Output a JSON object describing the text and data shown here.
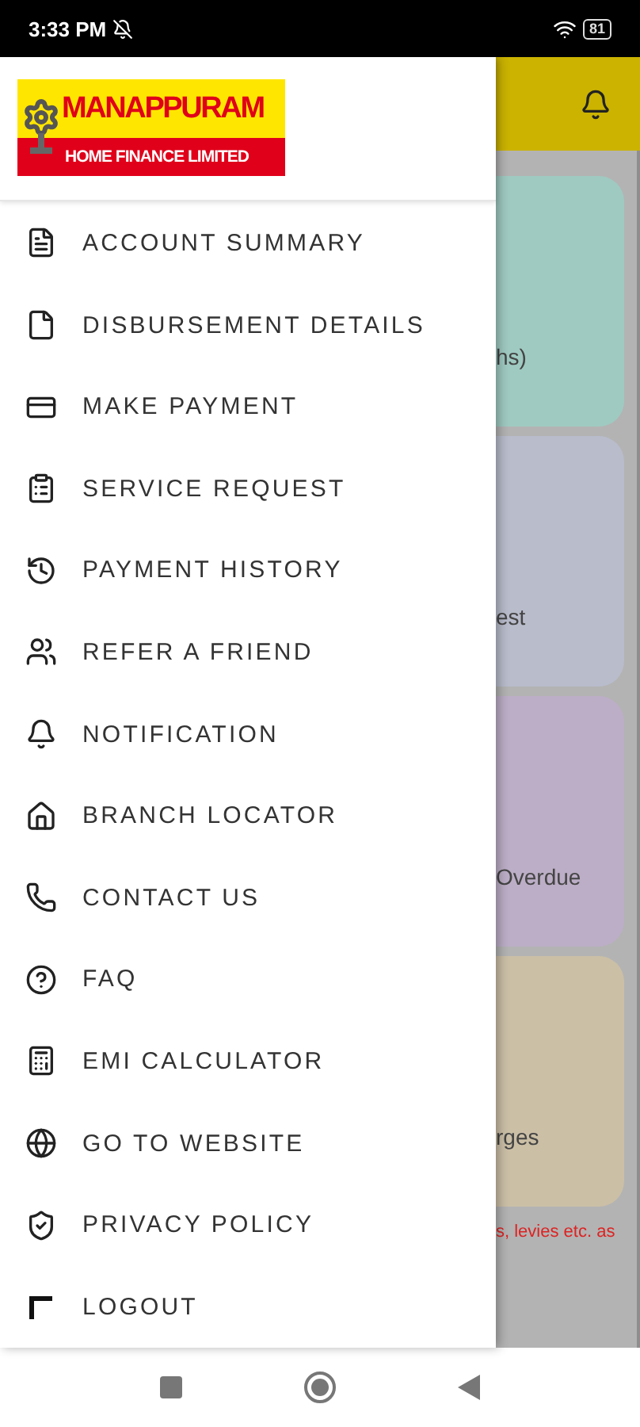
{
  "status_bar": {
    "time": "3:33 PM",
    "battery": "81"
  },
  "drawer": {
    "logo": {
      "title": "MANAPPURAM",
      "subtitle": "HOME FINANCE LIMITED"
    },
    "items": [
      {
        "label": "ACCOUNT SUMMARY"
      },
      {
        "label": "DISBURSEMENT DETAILS"
      },
      {
        "label": "MAKE PAYMENT"
      },
      {
        "label": "SERVICE REQUEST"
      },
      {
        "label": "PAYMENT HISTORY"
      },
      {
        "label": "REFER A FRIEND"
      },
      {
        "label": "NOTIFICATION"
      },
      {
        "label": "BRANCH LOCATOR"
      },
      {
        "label": "CONTACT US"
      },
      {
        "label": "FAQ"
      },
      {
        "label": "EMI CALCULATOR"
      },
      {
        "label": "GO TO WEBSITE"
      },
      {
        "label": "PRIVACY POLICY"
      },
      {
        "label": "LOGOUT"
      }
    ]
  },
  "background": {
    "cards": [
      {
        "text": "hs)",
        "color": "#9fcac1"
      },
      {
        "text": "est",
        "color": "#b8bccb"
      },
      {
        "text": "Overdue",
        "color": "#bcaec6"
      },
      {
        "text": "rges",
        "color": "#cbbfa6"
      }
    ],
    "note": "s, levies etc. as"
  }
}
